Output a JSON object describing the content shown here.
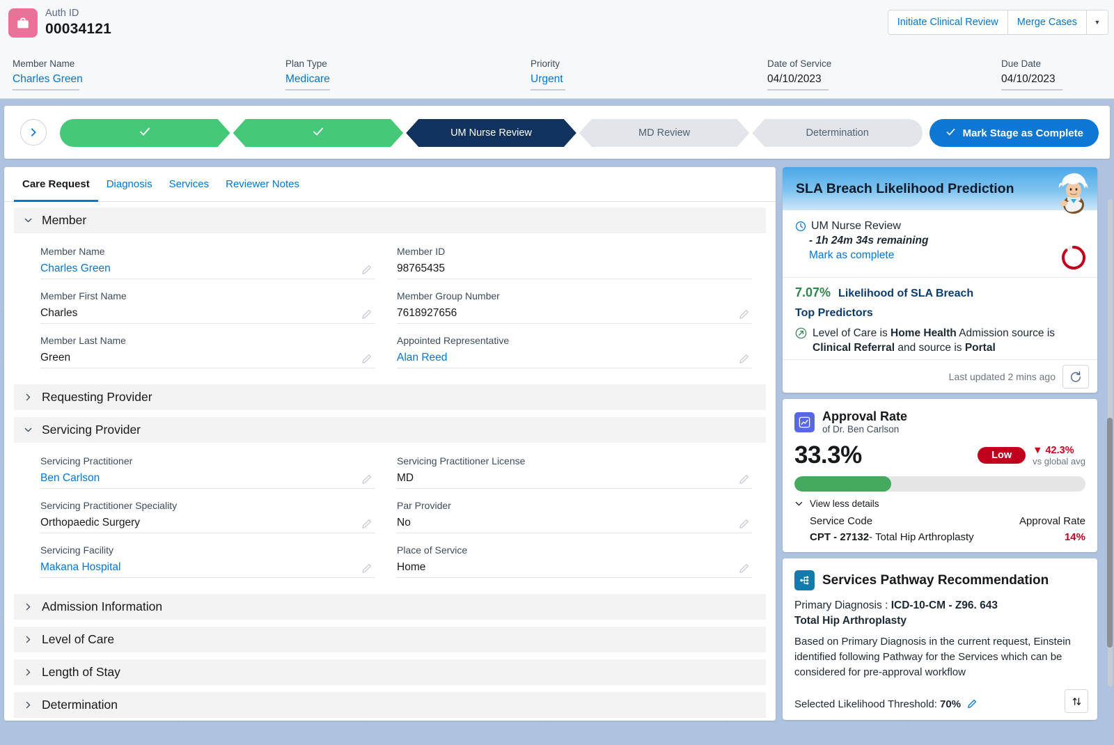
{
  "header": {
    "auth_label": "Auth ID",
    "auth_value": "00034121",
    "icon": "briefcase-icon",
    "buttons": [
      {
        "label": "Initiate Clinical Review"
      },
      {
        "label": "Merge Cases"
      }
    ],
    "more_caret": "▼",
    "fields": [
      {
        "label": "Member Name",
        "value": "Charles Green",
        "link": true
      },
      {
        "label": "Plan Type",
        "value": "Medicare",
        "link": true
      },
      {
        "label": "Priority",
        "value": "Urgent",
        "link": true
      },
      {
        "label": "Date of Service",
        "value": "04/10/2023",
        "link": false
      },
      {
        "label": "Due Date",
        "value": "04/10/2023",
        "link": false
      }
    ]
  },
  "stages": {
    "nav_icon": "chevron-right-icon",
    "items": [
      {
        "label": "",
        "state": "done",
        "check": "✓"
      },
      {
        "label": "",
        "state": "done",
        "check": "✓"
      },
      {
        "label": "UM Nurse Review",
        "state": "current"
      },
      {
        "label": "MD Review",
        "state": "todo"
      },
      {
        "label": "Determination",
        "state": "todo"
      }
    ],
    "mark_complete": "Mark Stage as Complete"
  },
  "tabs": [
    {
      "label": "Care Request",
      "active": true
    },
    {
      "label": "Diagnosis",
      "active": false
    },
    {
      "label": "Services",
      "active": false
    },
    {
      "label": "Reviewer Notes",
      "active": false
    }
  ],
  "sections": [
    {
      "title": "Member",
      "expanded": true,
      "left": [
        {
          "label": "Member Name",
          "value": "Charles Green",
          "link": true,
          "edit": true
        },
        {
          "label": "Member First Name",
          "value": "Charles",
          "link": false,
          "edit": true
        },
        {
          "label": "Member Last Name",
          "value": "Green",
          "link": false,
          "edit": true
        }
      ],
      "right": [
        {
          "label": "Member ID",
          "value": "98765435",
          "link": false,
          "edit": false
        },
        {
          "label": "Member Group Number",
          "value": "7618927656",
          "link": false,
          "edit": true
        },
        {
          "label": "Appointed Representative",
          "value": "Alan Reed",
          "link": true,
          "edit": true
        }
      ]
    },
    {
      "title": "Requesting Provider",
      "expanded": false
    },
    {
      "title": "Servicing Provider",
      "expanded": true,
      "left": [
        {
          "label": "Servicing Practitioner",
          "value": "Ben Carlson",
          "link": true,
          "edit": true
        },
        {
          "label": "Servicing Practitioner Speciality",
          "value": "Orthopaedic Surgery",
          "link": false,
          "edit": true
        },
        {
          "label": "Servicing Facility",
          "value": "Makana Hospital",
          "link": true,
          "edit": true
        }
      ],
      "right": [
        {
          "label": "Servicing Practitioner License",
          "value": "MD",
          "link": false,
          "edit": true
        },
        {
          "label": "Par Provider",
          "value": "No",
          "link": false,
          "edit": true
        },
        {
          "label": "Place of Service",
          "value": "Home",
          "link": false,
          "edit": true
        }
      ]
    },
    {
      "title": "Admission Information",
      "expanded": false
    },
    {
      "title": "Level of Care",
      "expanded": false
    },
    {
      "title": "Length of Stay",
      "expanded": false
    },
    {
      "title": "Determination",
      "expanded": false
    }
  ],
  "sla_panel": {
    "title": "SLA Breach Likelihood Prediction",
    "mascot": "einstein-avatar",
    "clock_icon": "clock-icon",
    "stage": "UM Nurse Review",
    "remaining": "- 1h 24m 34s remaining",
    "mark_as_complete": "Mark as complete",
    "likelihood_pct": "7.07%",
    "likelihood_label": "Likelihood of SLA Breach",
    "top_predictors_label": "Top Predictors",
    "predictor_parts": [
      {
        "text": "Level of Care is ",
        "bold": false
      },
      {
        "text": "Home Health",
        "bold": true
      },
      {
        "text": " Admission source is ",
        "bold": false
      },
      {
        "text": "Clinical Referral",
        "bold": true
      },
      {
        "text": " and source is ",
        "bold": false
      },
      {
        "text": "Portal",
        "bold": true
      }
    ],
    "last_updated": "Last updated 2 mins ago",
    "refresh_icon": "refresh-icon",
    "gauge_value": 7.07,
    "gauge_color": "#c1001d"
  },
  "approval_panel": {
    "icon": "line-chart-icon",
    "title": "Approval Rate",
    "subtitle": "of Dr. Ben Carlson",
    "value": "33.3%",
    "bar_percent": 33.3,
    "bar_color": "#45a85f",
    "badge": "Low",
    "badge_color": "#c1001d",
    "delta": "▼ 42.3%",
    "delta_sub": "vs global avg",
    "toggle_details": "View less details",
    "table": {
      "headers": [
        "Service Code",
        "Approval Rate"
      ],
      "rows": [
        {
          "code_bold": "CPT - 27132",
          "code_rest": "- Total Hip Arthroplasty",
          "rate": "14%"
        }
      ]
    }
  },
  "pathway_panel": {
    "icon": "pathway-icon",
    "title": "Services Pathway Recommendation",
    "dx_label": "Primary Diagnosis : ",
    "dx_code": "ICD-10-CM - Z96. 643",
    "dx_name": "Total Hip Arthroplasty",
    "description": "Based on Primary Diagnosis in the current request, Einstein identified following Pathway for the Services which can be considered for pre-approval workflow",
    "threshold_label": "Selected Likelihood Threshold: ",
    "threshold_value": "70%",
    "threshold_edit_icon": "pencil-icon",
    "sort_icon": "sort-icon"
  }
}
